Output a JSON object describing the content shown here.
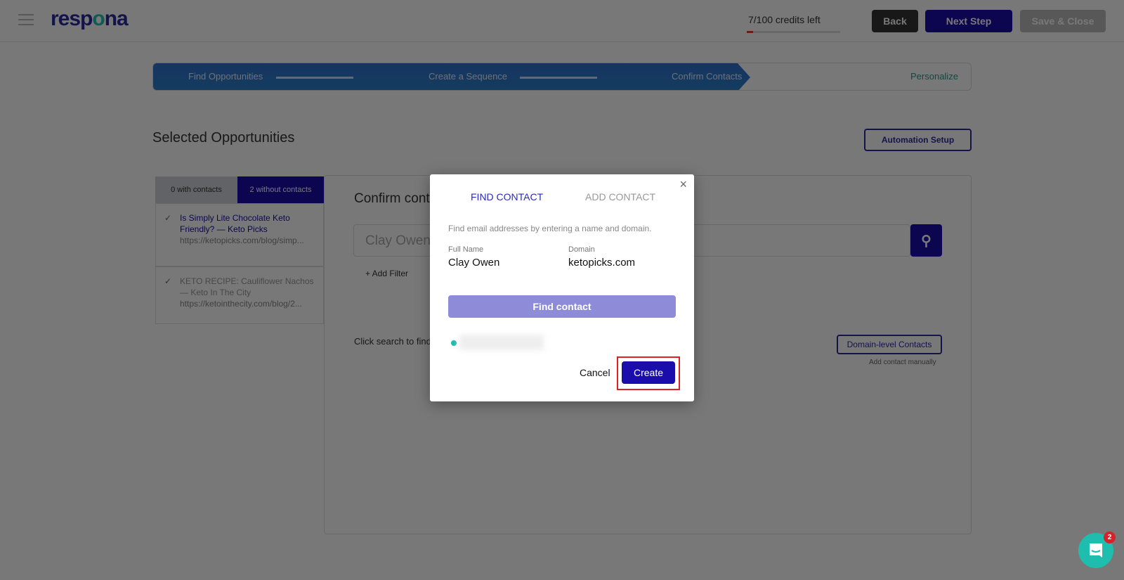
{
  "header": {
    "logo_text": "respona",
    "credits": "7/100 credits left",
    "credits_fraction": 0.07,
    "back": "Back",
    "next_step": "Next Step",
    "save_close": "Save & Close"
  },
  "stepper": {
    "steps": [
      "Find Opportunities",
      "Create a Sequence",
      "Confirm Contacts",
      "Personalize"
    ],
    "active_index": 2
  },
  "page": {
    "title": "Selected Opportunities",
    "automation_setup": "Automation Setup"
  },
  "left_panel": {
    "tabs": [
      "0 with contacts",
      "2 without contacts"
    ],
    "items": [
      {
        "title": "Is Simply Lite Chocolate Keto Friendly? — Keto Picks",
        "url": "https://ketopicks.com/blog/simp..."
      },
      {
        "title": "KETO RECIPE: Cauliflower Nachos — Keto In The City",
        "url": "https://ketointhecity.com/blog/2..."
      }
    ]
  },
  "right_panel": {
    "title": "Confirm contacts",
    "search_value": "Clay Owen",
    "add_filter": "+ Add Filter",
    "hint": "Click search to find contacts",
    "domain_contacts": "Domain-level Contacts",
    "add_manually": "Add contact manually"
  },
  "modal": {
    "tabs": [
      "FIND CONTACT",
      "ADD CONTACT"
    ],
    "active_tab": 0,
    "description": "Find email addresses by entering a name and domain.",
    "full_name_label": "Full Name",
    "full_name": "Clay Owen",
    "domain_label": "Domain",
    "domain": "ketopicks.com",
    "find_button": "Find contact",
    "cancel": "Cancel",
    "create": "Create"
  },
  "chat": {
    "badge": "2"
  },
  "colors": {
    "primary": "#1a0dab",
    "accent": "#1ebdad",
    "highlight": "#e02020"
  }
}
